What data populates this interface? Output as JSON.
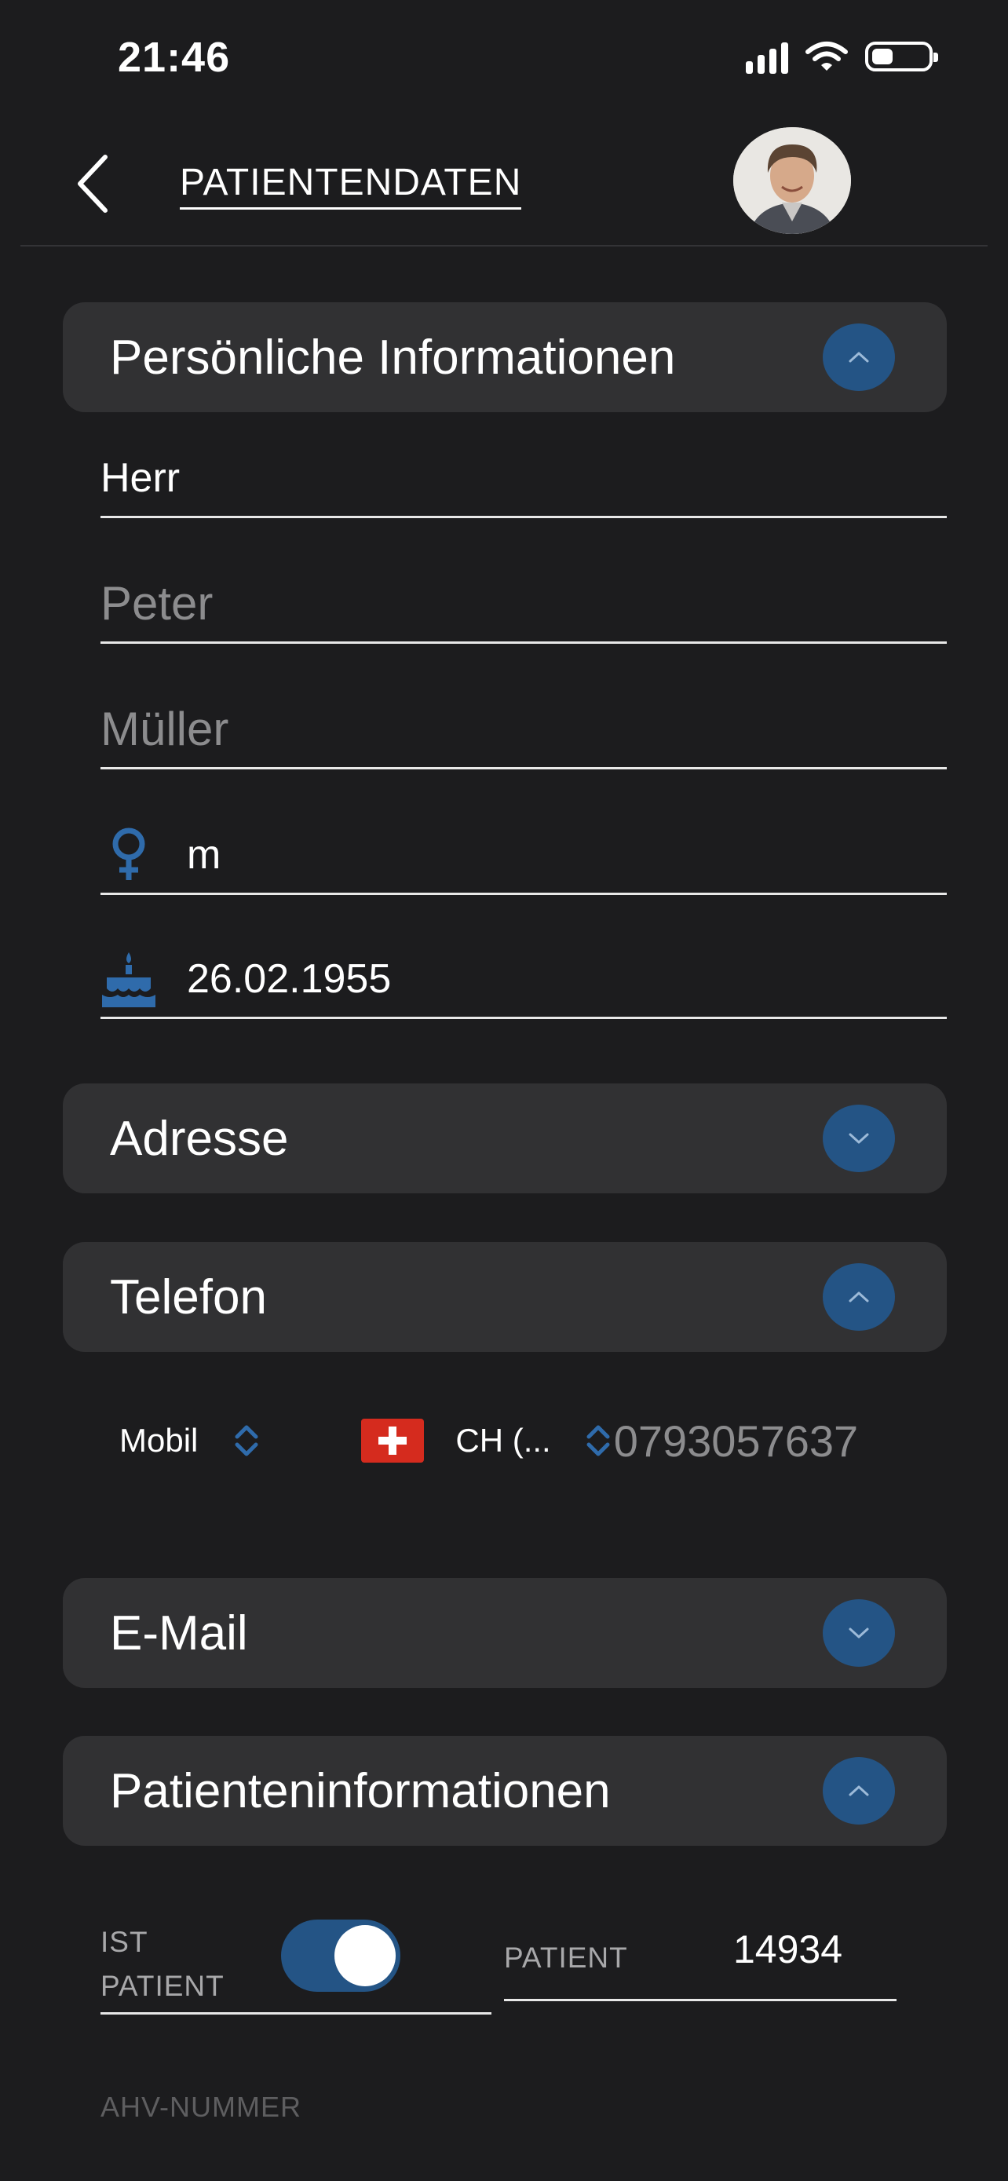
{
  "status_bar": {
    "time": "21:46",
    "battery_level": 0.3
  },
  "header": {
    "title": "PATIENTENDATEN"
  },
  "sections": {
    "personal": {
      "label": "Persönliche Informationen",
      "expanded": true
    },
    "address": {
      "label": "Adresse",
      "expanded": false
    },
    "phone": {
      "label": "Telefon",
      "expanded": true
    },
    "email": {
      "label": "E-Mail",
      "expanded": false
    },
    "patient_info": {
      "label": "Patienteninformationen",
      "expanded": true
    }
  },
  "personal": {
    "salutation": "Herr",
    "first_name_placeholder": "Peter",
    "last_name_placeholder": "Müller",
    "gender": "m",
    "birthdate": "26.02.1955"
  },
  "phone": {
    "type": "Mobil",
    "country": "CH (...",
    "number_placeholder": "0793057637"
  },
  "patient_info": {
    "is_patient_label_1": "IST",
    "is_patient_label_2": "PATIENT",
    "is_patient": true,
    "patient_label": "PATIENT",
    "patient_number": "14934",
    "ahv_label": "AHV-NUMMER"
  },
  "colors": {
    "accent": "#245485",
    "background": "#1c1c1e",
    "card": "#313133"
  },
  "icons": [
    "back-chevron-icon",
    "chevron-up-icon",
    "chevron-down-icon",
    "gender-icon",
    "birthday-cake-icon",
    "updown-icon",
    "swiss-flag-icon"
  ]
}
